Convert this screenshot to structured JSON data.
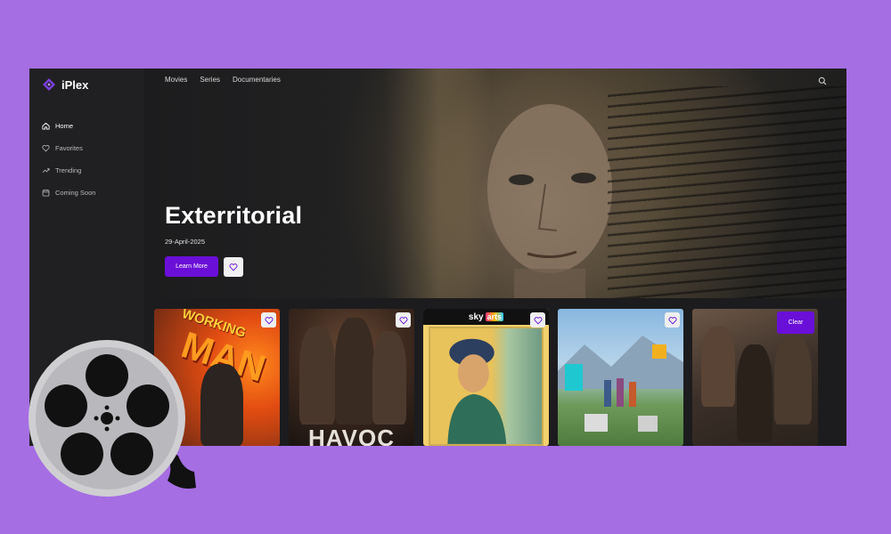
{
  "app": {
    "name": "iPlex"
  },
  "sidebar": {
    "items": [
      {
        "label": "Home",
        "icon": "home-icon",
        "active": true
      },
      {
        "label": "Favorites",
        "icon": "heart-icon",
        "active": false
      },
      {
        "label": "Trending",
        "icon": "trending-icon",
        "active": false
      },
      {
        "label": "Coming Soon",
        "icon": "calendar-icon",
        "active": false
      }
    ]
  },
  "topnav": {
    "items": [
      "Movies",
      "Series",
      "Documentaries"
    ]
  },
  "hero": {
    "title": "Exterritorial",
    "date": "29-April-2025",
    "learn_more": "Learn More"
  },
  "cards": [
    {
      "poster_text_1": "WORKING",
      "poster_text_2": "MAN"
    },
    {
      "poster_text": "HAVOC"
    },
    {
      "badge_1": "sky",
      "badge_2": "arts"
    },
    {},
    {
      "clear_label": "Clear"
    }
  ],
  "colors": {
    "background": "#a56ee3",
    "accent": "#6a0fd8",
    "panel": "#1c1c1e",
    "sidebar": "#202022"
  }
}
